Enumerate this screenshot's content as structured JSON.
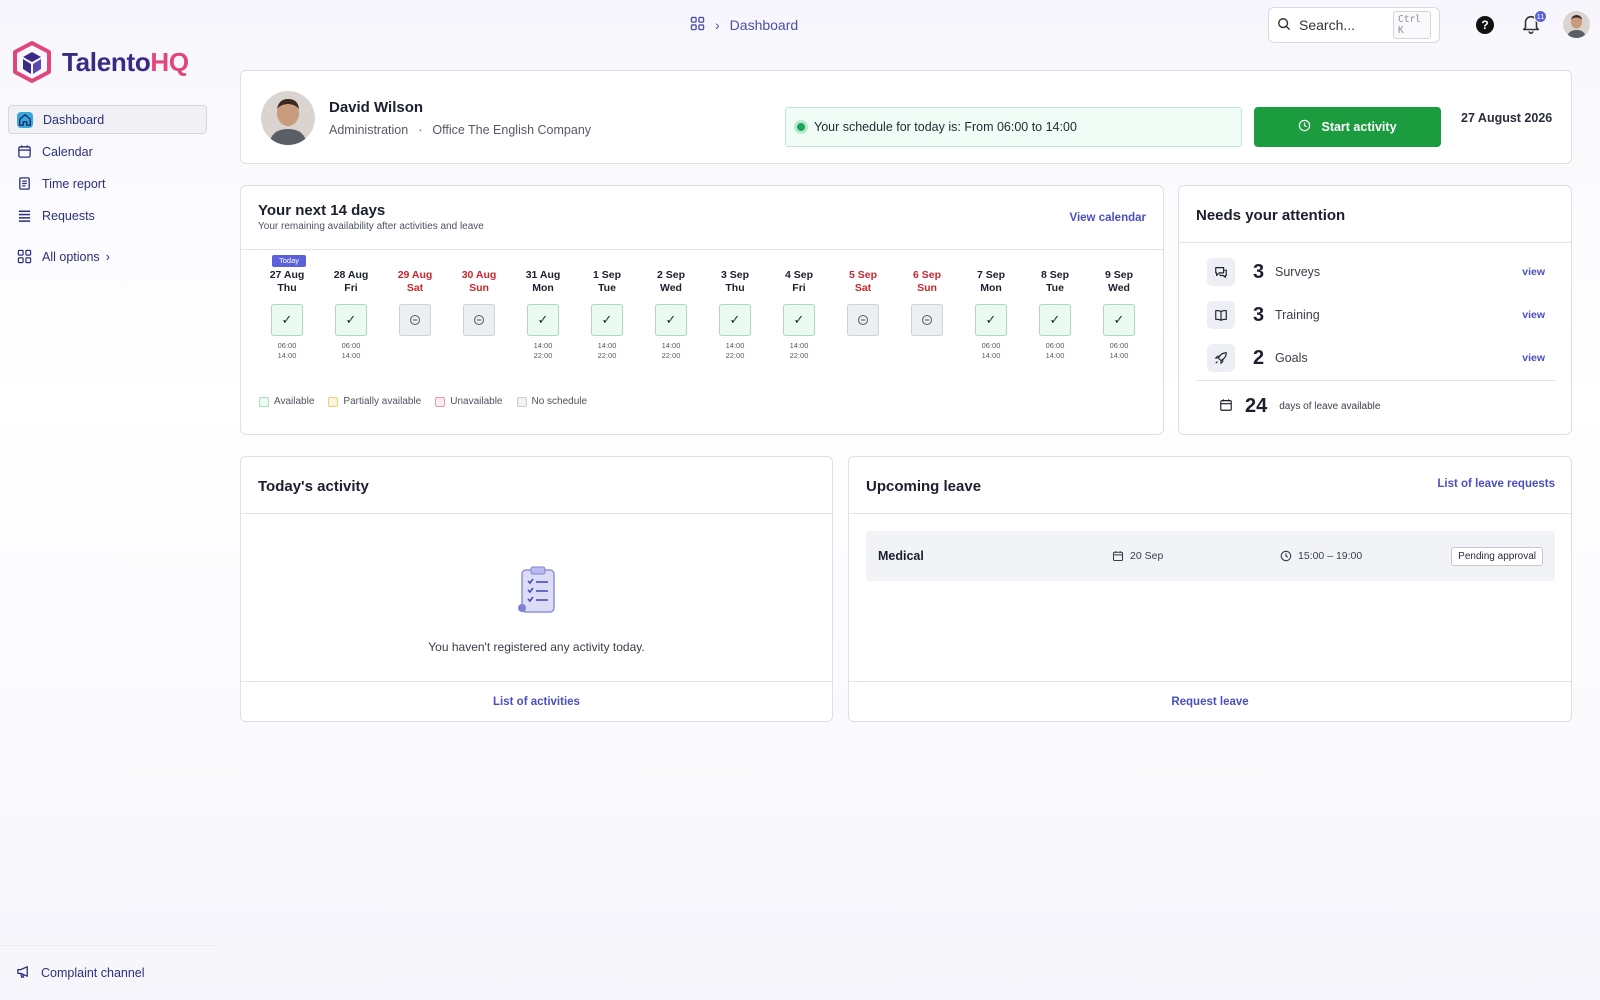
{
  "app": {
    "logo_part1": "Talento",
    "logo_part2": "HQ",
    "brand_primary": "#3a2a86",
    "brand_accent": "#e2457c"
  },
  "sidebar": {
    "items": [
      {
        "label": "Dashboard",
        "icon": "home-icon",
        "active": true
      },
      {
        "label": "Calendar",
        "icon": "calendar-icon"
      },
      {
        "label": "Time report",
        "icon": "report-icon"
      },
      {
        "label": "Requests",
        "icon": "list-icon"
      }
    ],
    "all_options": "All options",
    "complaint": "Complaint channel"
  },
  "topbar": {
    "breadcrumb": "Dashboard",
    "search_placeholder": "Search...",
    "search_shortcut": "Ctrl K",
    "help": "?",
    "notifications_count": "11"
  },
  "profile": {
    "name": "David Wilson",
    "department": "Administration",
    "separator": "·",
    "office": "Office The English Company",
    "schedule_text": "Your schedule for today is: From 06:00 to 14:00",
    "start_button": "Start activity",
    "date": "27 August 2026"
  },
  "next14": {
    "title": "Your next 14 days",
    "subtitle": "Your remaining availability after activities and leave",
    "view_calendar": "View calendar",
    "today_label": "Today",
    "days": [
      {
        "date": "27 Aug",
        "dow": "Thu",
        "status": "available",
        "start": "06:00",
        "end": "14:00",
        "today": true
      },
      {
        "date": "28 Aug",
        "dow": "Fri",
        "status": "available",
        "start": "06:00",
        "end": "14:00"
      },
      {
        "date": "29 Aug",
        "dow": "Sat",
        "status": "none",
        "weekend": true
      },
      {
        "date": "30 Aug",
        "dow": "Sun",
        "status": "none",
        "weekend": true
      },
      {
        "date": "31 Aug",
        "dow": "Mon",
        "status": "available",
        "start": "14:00",
        "end": "22:00"
      },
      {
        "date": "1 Sep",
        "dow": "Tue",
        "status": "available",
        "start": "14:00",
        "end": "22:00"
      },
      {
        "date": "2 Sep",
        "dow": "Wed",
        "status": "available",
        "start": "14:00",
        "end": "22:00"
      },
      {
        "date": "3 Sep",
        "dow": "Thu",
        "status": "available",
        "start": "14:00",
        "end": "22:00"
      },
      {
        "date": "4 Sep",
        "dow": "Fri",
        "status": "available",
        "start": "14:00",
        "end": "22:00"
      },
      {
        "date": "5 Sep",
        "dow": "Sat",
        "status": "none",
        "weekend": true
      },
      {
        "date": "6 Sep",
        "dow": "Sun",
        "status": "none",
        "weekend": true
      },
      {
        "date": "7 Sep",
        "dow": "Mon",
        "status": "available",
        "start": "06:00",
        "end": "14:00"
      },
      {
        "date": "8 Sep",
        "dow": "Tue",
        "status": "available",
        "start": "06:00",
        "end": "14:00"
      },
      {
        "date": "9 Sep",
        "dow": "Wed",
        "status": "available",
        "start": "06:00",
        "end": "14:00"
      }
    ],
    "legend": [
      {
        "label": "Available",
        "bg": "#ecfbf2",
        "border": "#a7dcbc"
      },
      {
        "label": "Partially available",
        "bg": "#fdf6dc",
        "border": "#e8cf7a"
      },
      {
        "label": "Unavailable",
        "bg": "#fdecef",
        "border": "#e59aab"
      },
      {
        "label": "No schedule",
        "bg": "#f2f3f5",
        "border": "#c8cbd2"
      }
    ]
  },
  "attention": {
    "title": "Needs your attention",
    "items": [
      {
        "count": "3",
        "label": "Surveys",
        "view": "view",
        "icon": "survey-icon"
      },
      {
        "count": "3",
        "label": "Training",
        "view": "view",
        "icon": "book-icon"
      },
      {
        "count": "2",
        "label": "Goals",
        "view": "view",
        "icon": "rocket-icon"
      }
    ],
    "leave_days": "24",
    "leave_days_label": "days of leave available"
  },
  "activity": {
    "title": "Today's activity",
    "empty_text": "You haven't registered any activity today.",
    "footer_link": "List of activities"
  },
  "leave": {
    "title": "Upcoming leave",
    "header_link": "List of leave requests",
    "items": [
      {
        "type": "Medical",
        "date": "20 Sep",
        "time": "15:00 – 19:00",
        "status": "Pending approval"
      }
    ],
    "footer_link": "Request leave"
  }
}
